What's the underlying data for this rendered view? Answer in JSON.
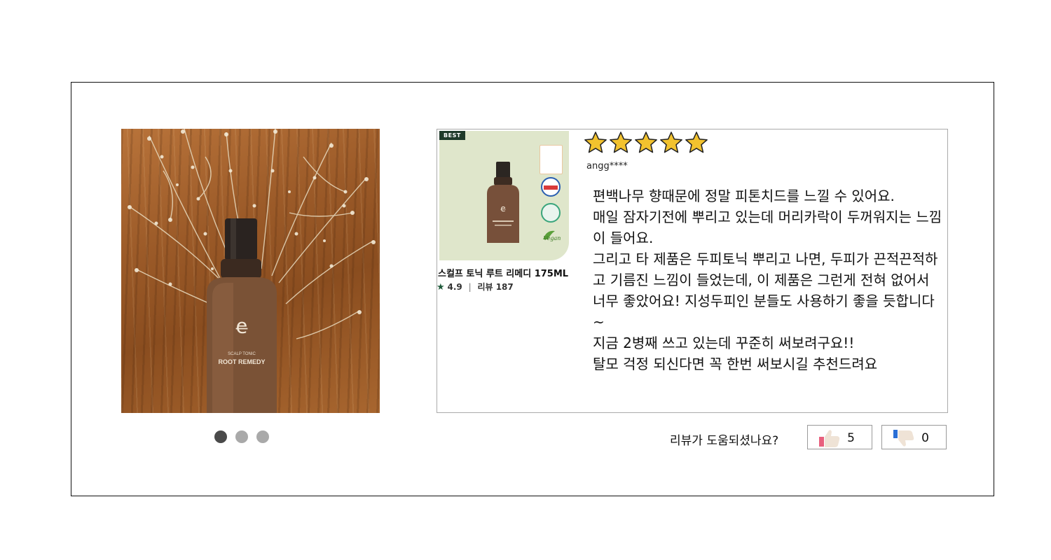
{
  "product": {
    "badge": "BEST",
    "name": "스컬프 토닉 루트 리메디 175ML",
    "rating": "4.9",
    "separator": "|",
    "review_count": "리뷰 187",
    "bottle_label_line1": "SCALP TONIC",
    "bottle_label_line2": "ROOT REMEDY"
  },
  "gallery": {
    "slide_count": 3,
    "active_index": 0
  },
  "review": {
    "rating": 5,
    "max_rating": 5,
    "user": "angg****",
    "lines": [
      "편백나무 향때문에 정말 피톤치드를 느낄 수 있어요.",
      "매일 잠자기전에 뿌리고 있는데 머리카락이 두꺼워지는 느낌이 들어요.",
      "그리고 타 제품은 두피토닉 뿌리고 나면, 두피가 끈적끈적하고 기름진 느낌이 들었는데, 이 제품은 그런게 전혀 없어서 너무 좋았어요! 지성두피인 분들도 사용하기 좋을 듯합니다~",
      "지금 2병째 쓰고 있는데 꾸준히 써보려구요!!",
      "탈모 걱정 되신다면 꼭 한번  써보시길 추천드려요"
    ]
  },
  "helpful": {
    "question": "리뷰가 도움되셨나요?",
    "up_count": "5",
    "down_count": "0"
  },
  "colors": {
    "star_fill": "#f2c22e",
    "star_stroke": "#222222",
    "thumb_bg": "#dfe6cb",
    "best_badge": "#1f3a2a",
    "dot_active": "#4a4a4a",
    "dot_inactive": "#a9a9a9",
    "like_accent": "#e8607e",
    "dislike_accent": "#2a6fd6"
  }
}
